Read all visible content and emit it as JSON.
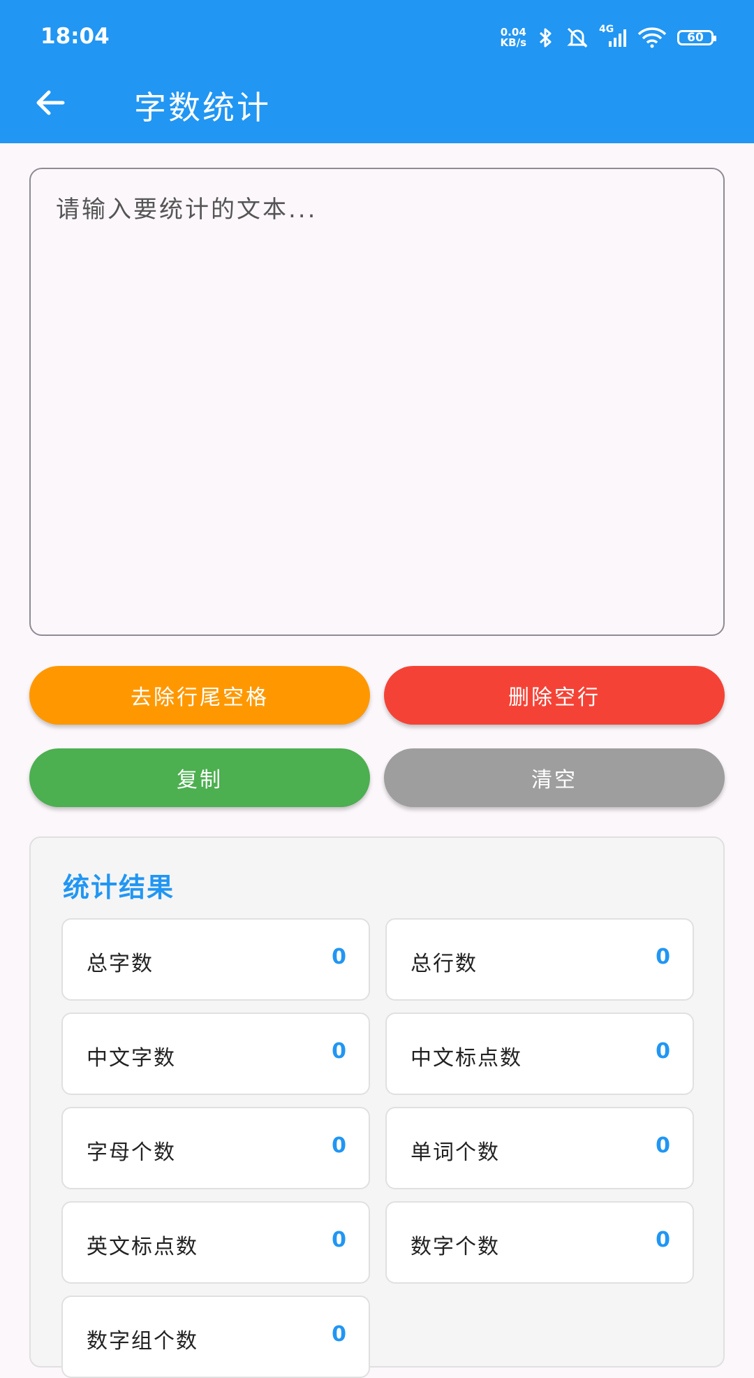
{
  "status_bar": {
    "time": "18:04",
    "net_speed_value": "0.04",
    "net_speed_unit": "KB/s",
    "network_type": "4G",
    "battery": "60",
    "icons": [
      "bluetooth-icon",
      "mute-bell-icon",
      "signal-icon",
      "wifi-icon",
      "battery-icon"
    ]
  },
  "app_bar": {
    "back_icon": "arrow-left-icon",
    "title": "字数统计"
  },
  "input": {
    "placeholder": "请输入要统计的文本...",
    "value": ""
  },
  "buttons": {
    "trim_trailing": "去除行尾空格",
    "delete_blank_lines": "删除空行",
    "copy": "复制",
    "clear": "清空"
  },
  "colors": {
    "primary": "#2196F3",
    "orange": "#FF9800",
    "red": "#F44336",
    "green": "#4CAF50",
    "gray": "#9E9E9E"
  },
  "stats": {
    "title": "统计结果",
    "items": [
      {
        "label": "总字数",
        "value": "0"
      },
      {
        "label": "总行数",
        "value": "0"
      },
      {
        "label": "中文字数",
        "value": "0"
      },
      {
        "label": "中文标点数",
        "value": "0"
      },
      {
        "label": "字母个数",
        "value": "0"
      },
      {
        "label": "单词个数",
        "value": "0"
      },
      {
        "label": "英文标点数",
        "value": "0"
      },
      {
        "label": "数字个数",
        "value": "0"
      },
      {
        "label": "数字组个数",
        "value": "0"
      }
    ]
  }
}
